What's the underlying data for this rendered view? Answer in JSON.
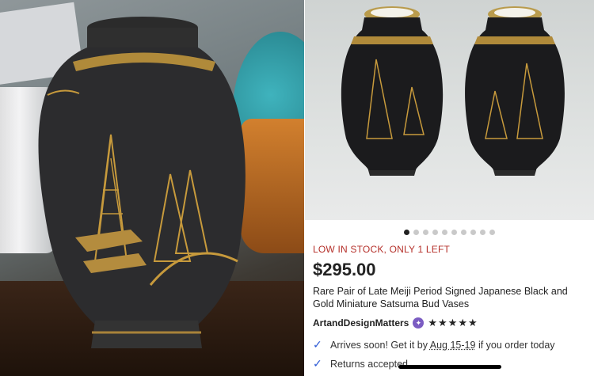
{
  "listing": {
    "stock_label": "LOW IN STOCK, ONLY 1 LEFT",
    "price": "$295.00",
    "title": "Rare Pair of Late Meiji Period Signed Japanese Black and Gold Miniature Satsuma Bud Vases",
    "seller": "ArtandDesignMatters",
    "rating": 5,
    "stars": "★★★★★",
    "delivery_prefix": "Arrives soon! Get it by",
    "delivery_dates": "Aug 15-19",
    "delivery_suffix": "if you order today",
    "returns": "Returns accepted"
  },
  "carousel": {
    "count": 10,
    "active_index": 0
  },
  "colors": {
    "stock_red": "#b5302a",
    "check_blue": "#2e5bd6",
    "star_badge_purple": "#7b5cc2"
  },
  "icons": [
    "check-icon",
    "star-seller-badge-icon",
    "rating-star-icon"
  ]
}
